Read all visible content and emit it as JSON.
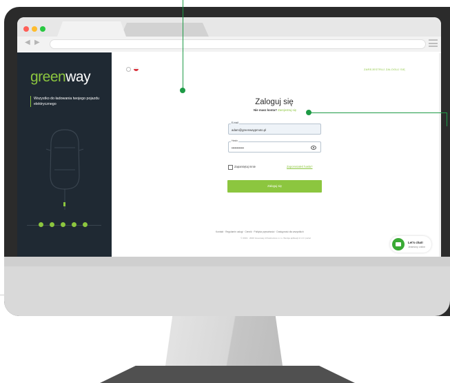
{
  "browser": {
    "nav_back": "◀",
    "nav_forward": "▶",
    "traffic_lights": [
      "#ff5f57",
      "#febc2e",
      "#28c840"
    ]
  },
  "sidebar": {
    "logo_green": "green",
    "logo_white": "way",
    "tagline": "Wszystko do ładowania twojego pojazdu elektrycznego"
  },
  "header": {
    "top_links": "ZAREJESTRUJ   ZALOGUJ SIĘ"
  },
  "login": {
    "title": "Zaloguj się",
    "no_account": "Nie masz konta?",
    "register_link": "Zarejestruj się",
    "email_label": "E-mail",
    "email_value": "adam@greenwaypmoto.pl",
    "password_label": "Hasło",
    "password_value": "••••••••••••",
    "remember_me": "Zapamiętaj mnie",
    "forgot_password": "Zapomniałeś hasła?",
    "submit": "Zaloguj się"
  },
  "footer": {
    "links": "Kontakt · Regulamin usługi · Cennik · Polityka prywatności · Dostępność dla wszystkich",
    "copyright": "© 2019 · 2020 Greenway Infrastructure s.r.o. Wersja aplikacji 2.1.0 / portal"
  },
  "chat": {
    "title": "Let's chat!",
    "subtitle": "Jesteśmy online"
  },
  "colors": {
    "brand_green": "#8cc63f",
    "sidebar_bg": "#1f2933",
    "callout_green": "#1d9a45"
  }
}
